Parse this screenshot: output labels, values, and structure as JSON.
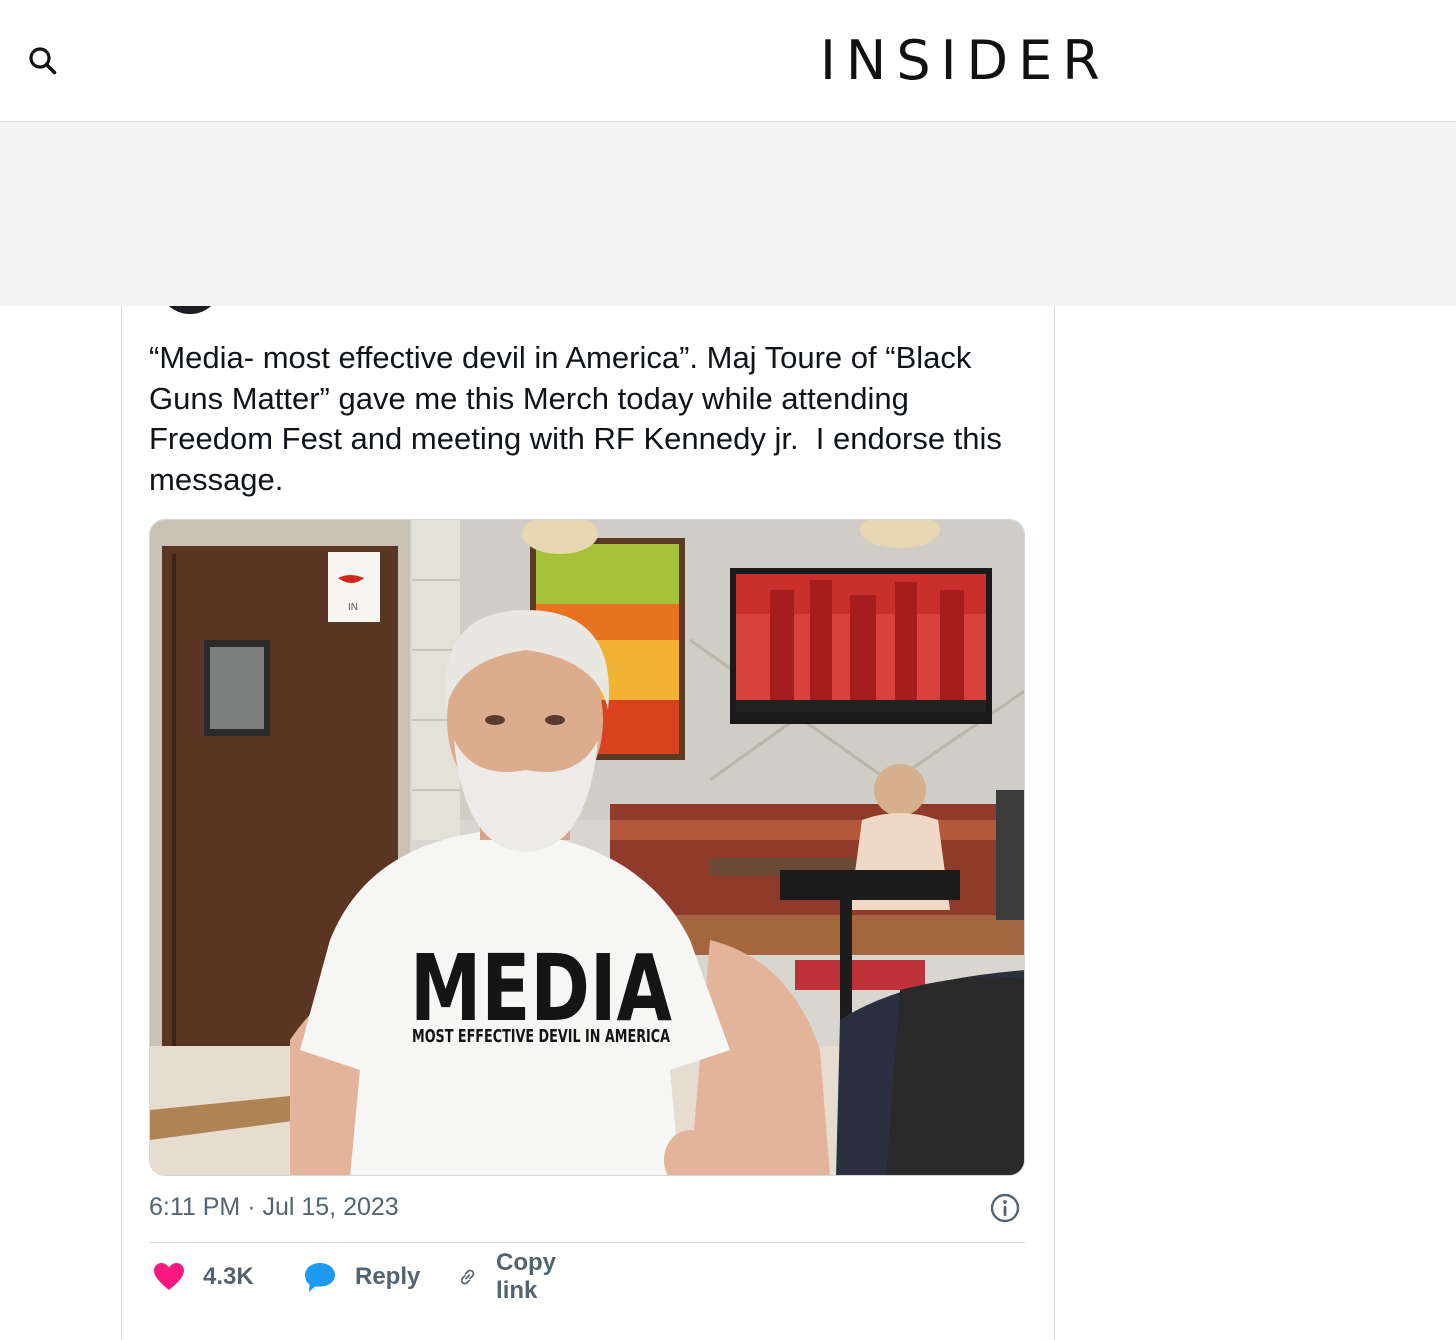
{
  "header": {
    "logo_text": "INSIDER",
    "search_icon": "search-icon"
  },
  "tweet": {
    "text": "“Media- most effective devil in America”. Maj Toure of “Black Guns Matter” gave me this Merch today while attending Freedom Fest and meeting with RF Kennedy jr.  I endorse this message.",
    "photo": {
      "shirt_line1": "MEDIA",
      "shirt_line2": "MOST EFFECTIVE DEVIL IN AMERICA",
      "sign_text": "IN"
    },
    "timestamp": "6:11 PM · Jul 15, 2023",
    "actions": {
      "like_count": "4.3K",
      "reply_label": "Reply",
      "copy_link_label": "Copy link"
    }
  },
  "colors": {
    "like": "#f91880",
    "reply": "#1d9bf0",
    "secondary_text": "#536471",
    "primary_text": "#0f1419",
    "border": "#cfd9de"
  }
}
